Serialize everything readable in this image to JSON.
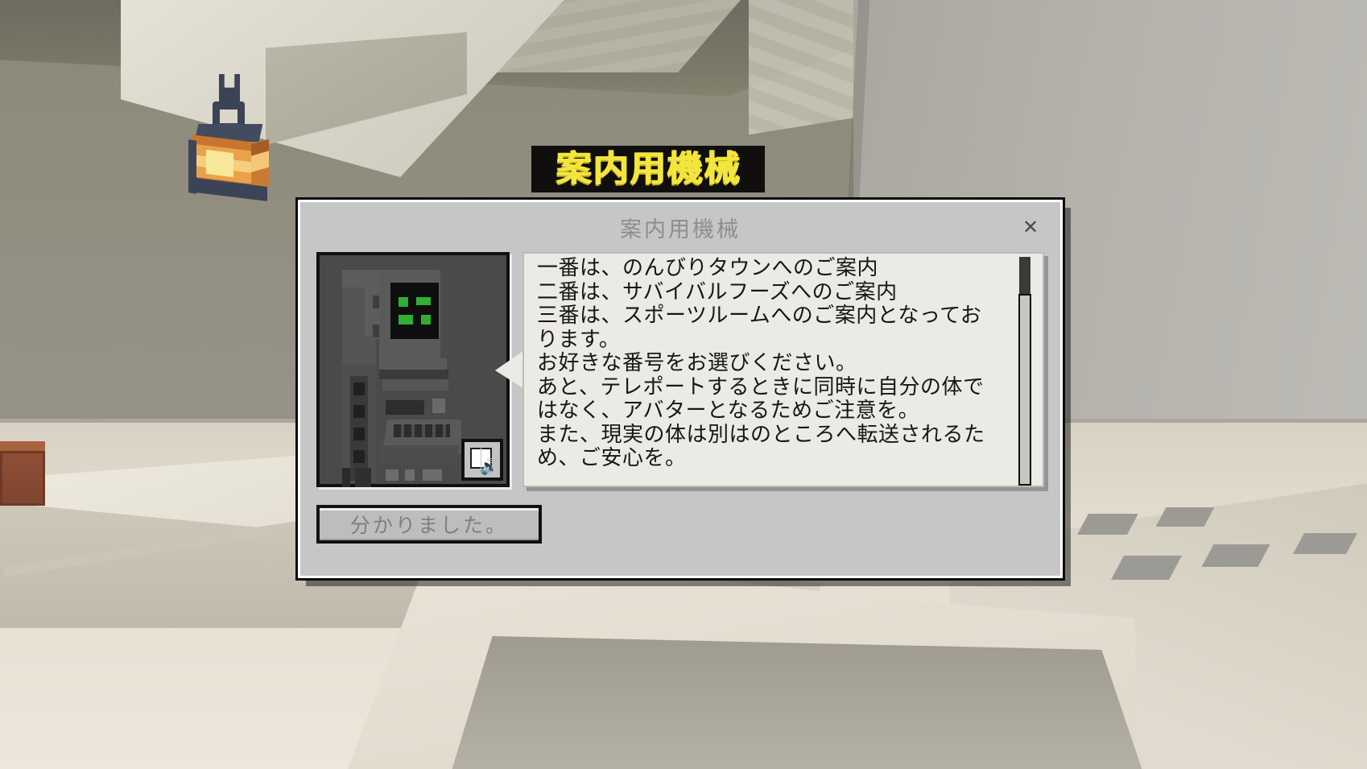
{
  "scene": {
    "sign_text": "案内用機械",
    "lantern_icon": "lantern-icon"
  },
  "dialog": {
    "title": "案内用機械",
    "close_label": "✕",
    "portrait": {
      "alt": "guide-machine-portrait",
      "audio_button_icon": "book-speaker-icon"
    },
    "speech": {
      "lines": [
        "一番は、のんびりタウンへのご案内",
        "二番は、サバイバルフーズへのご案内",
        "三番は、スポーツルームへのご案内となってお",
        "ります。",
        "お好きな番号をお選びください。",
        "あと、テレポートするときに同時に自分の体で",
        "はなく、アバターとなるためご注意を。",
        "また、現実の体は別はのところへ転送されるた",
        "め、ご安心を。"
      ]
    },
    "scrollbar": {
      "thumb_position": "top"
    },
    "ok_button": "分かりました。"
  },
  "colors": {
    "dialog_bg": "#c6c6c6",
    "bubble_bg": "#eceae4",
    "title_text": "#8e8e8e",
    "body_text": "#161616",
    "sign_text": "#f3e53c",
    "sign_bg": "#100f0d",
    "led_green": "#2faf33",
    "speaker_blue": "#2f72d8"
  }
}
